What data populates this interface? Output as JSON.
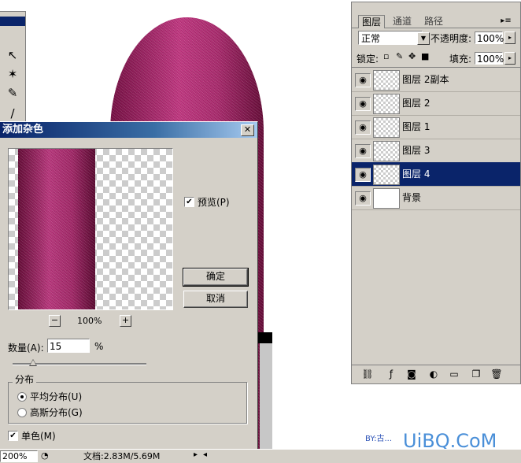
{
  "dialog": {
    "title": "添加杂色",
    "ok_label": "确定",
    "cancel_label": "取消",
    "preview_label": "预览(P)",
    "preview_checked": true,
    "zoom_minus": "−",
    "zoom_value": "100%",
    "zoom_plus": "+",
    "amount_label": "数量(A):",
    "amount_value": "15",
    "amount_unit": "%",
    "amount_slider_fraction": 0.15,
    "distribution_label": "分布",
    "uniform_label": "平均分布(U)",
    "gaussian_label": "高斯分布(G)",
    "distribution_selected": "uniform",
    "mono_label": "单色(M)",
    "mono_checked": true
  },
  "layers_panel": {
    "tabs": [
      "图层",
      "通道",
      "路径"
    ],
    "blend_mode": "正常",
    "opacity_label": "不透明度:",
    "opacity_value": "100%",
    "lock_label": "锁定:",
    "fill_label": "填充:",
    "fill_value": "100%",
    "layers": [
      {
        "name": "图层 2副本",
        "selected": false
      },
      {
        "name": "图层 2",
        "selected": false
      },
      {
        "name": "图层 1",
        "selected": false
      },
      {
        "name": "图层 3",
        "selected": false
      },
      {
        "name": "图层 4",
        "selected": true
      },
      {
        "name": "背景",
        "selected": false
      }
    ]
  },
  "status": {
    "zoom": "200%",
    "doc_info": "文档:2.83M/5.69M"
  },
  "watermark": {
    "small": "BY:古...",
    "large": "UiBQ.CoM"
  },
  "colors": {
    "title_bar": "#0a246a",
    "dialog_bg": "#d4d0c8",
    "lipstick": "#c83a86",
    "selected_row": "#0a246a"
  }
}
